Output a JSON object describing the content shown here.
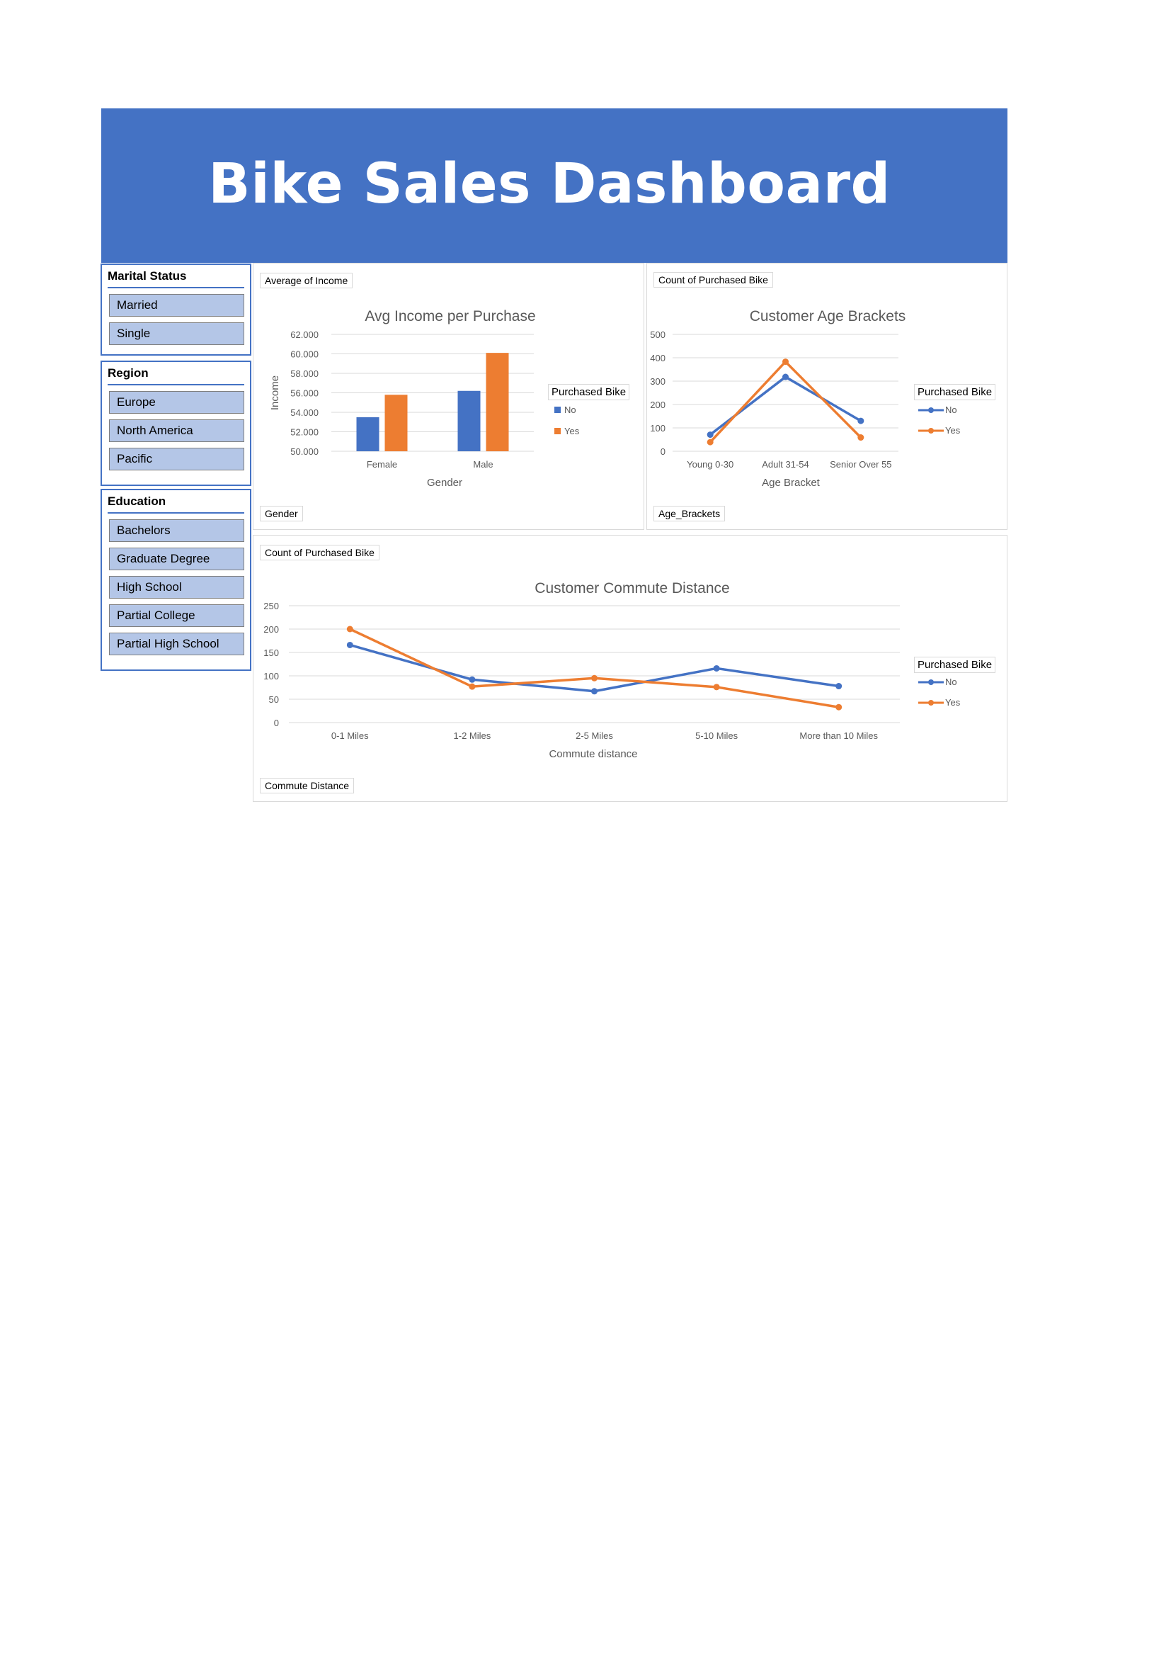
{
  "header": {
    "title": "Bike Sales Dashboard"
  },
  "slicers": [
    {
      "title": "Marital Status",
      "items": [
        "Married",
        "Single"
      ]
    },
    {
      "title": "Region",
      "items": [
        "Europe",
        "North America",
        "Pacific"
      ]
    },
    {
      "title": "Education",
      "items": [
        "Bachelors",
        "Graduate Degree",
        "High School",
        "Partial College",
        "Partial High School"
      ]
    }
  ],
  "colors": {
    "banner": "#4472c4",
    "no": "#4472c4",
    "yes": "#ed7d31",
    "slicer_item": "#b4c6e7"
  },
  "charts": {
    "income": {
      "value_field": "Average of Income",
      "axis_field": "Gender",
      "legend_title": "Purchased Bike",
      "legend": [
        "No",
        "Yes"
      ]
    },
    "age": {
      "value_field": "Count of Purchased Bike",
      "axis_field": "Age_Brackets",
      "legend_title": "Purchased Bike",
      "legend": [
        "No",
        "Yes"
      ]
    },
    "commute": {
      "value_field": "Count of Purchased Bike",
      "axis_field": "Commute Distance",
      "legend_title": "Purchased Bike",
      "legend": [
        "No",
        "Yes"
      ]
    }
  },
  "chart_data": [
    {
      "type": "bar",
      "title": "Avg Income per Purchase",
      "xlabel": "Gender",
      "ylabel": "Income",
      "categories": [
        "Female",
        "Male"
      ],
      "series": [
        {
          "name": "No",
          "values": [
            53500,
            56200
          ]
        },
        {
          "name": "Yes",
          "values": [
            55800,
            60100
          ]
        }
      ],
      "ylim": [
        50000,
        62000
      ],
      "yticks": [
        "50.000",
        "52.000",
        "54.000",
        "56.000",
        "58.000",
        "60.000",
        "62.000"
      ],
      "grid": true,
      "legend_position": "right"
    },
    {
      "type": "line",
      "title": "Customer Age Brackets",
      "xlabel": "Age Bracket",
      "ylabel": "",
      "categories": [
        "Young 0-30",
        "Adult 31-54",
        "Senior Over 55"
      ],
      "series": [
        {
          "name": "No",
          "values": [
            71,
            318,
            130
          ]
        },
        {
          "name": "Yes",
          "values": [
            39,
            383,
            59
          ]
        }
      ],
      "ylim": [
        0,
        500
      ],
      "yticks": [
        "0",
        "100",
        "200",
        "300",
        "400",
        "500"
      ],
      "grid": true,
      "legend_position": "right"
    },
    {
      "type": "line",
      "title": "Customer Commute Distance",
      "xlabel": "Commute distance",
      "ylabel": "",
      "categories": [
        "0-1 Miles",
        "1-2 Miles",
        "2-5 Miles",
        "5-10 Miles",
        "More than 10 Miles"
      ],
      "series": [
        {
          "name": "No",
          "values": [
            166,
            92,
            67,
            116,
            78
          ]
        },
        {
          "name": "Yes",
          "values": [
            200,
            77,
            95,
            76,
            33
          ]
        }
      ],
      "ylim": [
        0,
        250
      ],
      "yticks": [
        "0",
        "50",
        "100",
        "150",
        "200",
        "250"
      ],
      "grid": true,
      "legend_position": "right"
    }
  ]
}
